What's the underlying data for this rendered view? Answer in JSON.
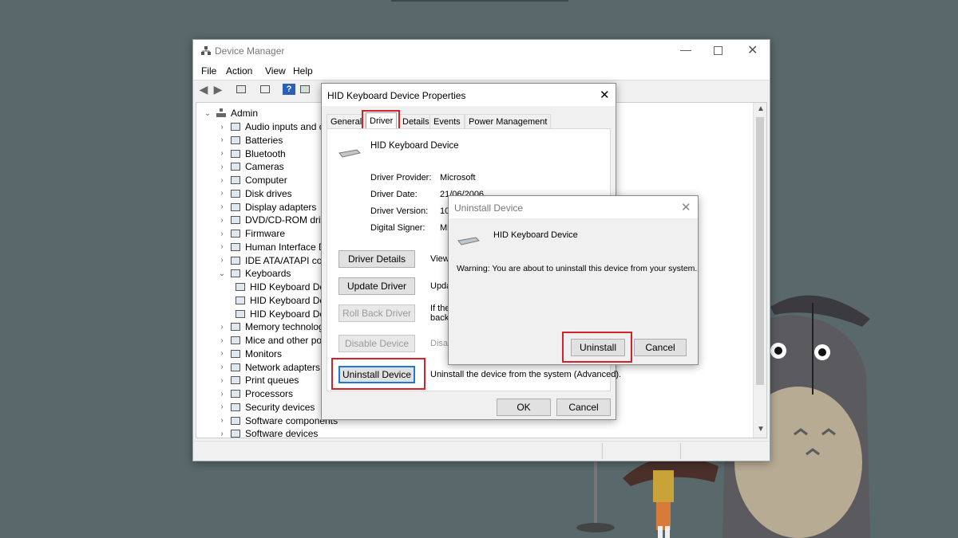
{
  "device_manager": {
    "title": "Device Manager",
    "menu": [
      "File",
      "Action",
      "View",
      "Help"
    ],
    "tree": {
      "root": "Admin",
      "items": [
        {
          "label": "Audio inputs and ou",
          "expanded": false,
          "icon": "speaker-icon"
        },
        {
          "label": "Batteries",
          "expanded": false,
          "icon": "battery-icon"
        },
        {
          "label": "Bluetooth",
          "expanded": false,
          "icon": "bluetooth-icon"
        },
        {
          "label": "Cameras",
          "expanded": false,
          "icon": "camera-icon"
        },
        {
          "label": "Computer",
          "expanded": false,
          "icon": "monitor-icon"
        },
        {
          "label": "Disk drives",
          "expanded": false,
          "icon": "disk-icon"
        },
        {
          "label": "Display adapters",
          "expanded": false,
          "icon": "display-adapter-icon"
        },
        {
          "label": "DVD/CD-ROM drive",
          "expanded": false,
          "icon": "dvd-icon"
        },
        {
          "label": "Firmware",
          "expanded": false,
          "icon": "chip-icon"
        },
        {
          "label": "Human Interface De",
          "expanded": false,
          "icon": "hid-icon"
        },
        {
          "label": "IDE ATA/ATAPI contr",
          "expanded": false,
          "icon": "ide-icon"
        },
        {
          "label": "Keyboards",
          "expanded": true,
          "icon": "keyboard-icon"
        },
        {
          "label": "HID Keyboard De",
          "child": true,
          "icon": "keyboard-icon"
        },
        {
          "label": "HID Keyboard De",
          "child": true,
          "icon": "keyboard-icon"
        },
        {
          "label": "HID Keyboard De",
          "child": true,
          "icon": "keyboard-icon"
        },
        {
          "label": "Memory technolog",
          "expanded": false,
          "icon": "memory-icon"
        },
        {
          "label": "Mice and other poin",
          "expanded": false,
          "icon": "mouse-icon"
        },
        {
          "label": "Monitors",
          "expanded": false,
          "icon": "monitor-icon"
        },
        {
          "label": "Network adapters",
          "expanded": false,
          "icon": "network-icon"
        },
        {
          "label": "Print queues",
          "expanded": false,
          "icon": "printer-icon"
        },
        {
          "label": "Processors",
          "expanded": false,
          "icon": "processor-icon"
        },
        {
          "label": "Security devices",
          "expanded": false,
          "icon": "security-icon"
        },
        {
          "label": "Software components",
          "expanded": false,
          "icon": "software-icon"
        },
        {
          "label": "Software devices",
          "expanded": false,
          "icon": "software-device-icon"
        }
      ]
    }
  },
  "properties_dialog": {
    "title": "HID Keyboard Device Properties",
    "tabs": [
      "General",
      "Driver",
      "Details",
      "Events",
      "Power Management"
    ],
    "active_tab": "Driver",
    "device_name": "HID Keyboard Device",
    "fields": [
      {
        "label": "Driver Provider:",
        "value": "Microsoft"
      },
      {
        "label": "Driver Date:",
        "value": "21/06/2006"
      },
      {
        "label": "Driver Version:",
        "value": "10"
      },
      {
        "label": "Digital Signer:",
        "value": "Mi"
      }
    ],
    "actions": [
      {
        "button": "Driver Details",
        "desc": "View",
        "enabled": true
      },
      {
        "button": "Update Driver",
        "desc": "Upda",
        "enabled": true
      },
      {
        "button": "Roll Back Driver",
        "desc": "If the\nback",
        "enabled": false
      },
      {
        "button": "Disable Device",
        "desc": "Disa",
        "enabled": false
      },
      {
        "button": "Uninstall Device",
        "desc": "Uninstall the device from the system (Advanced).",
        "enabled": true
      }
    ],
    "ok_label": "OK",
    "cancel_label": "Cancel"
  },
  "uninstall_dialog": {
    "title": "Uninstall Device",
    "device_name": "HID Keyboard Device",
    "warning": "Warning: You are about to uninstall this device from your system.",
    "uninstall_label": "Uninstall",
    "cancel_label": "Cancel"
  },
  "colors": {
    "highlight": "#d2232a",
    "background": "#59686a",
    "focus": "#1e78d6"
  }
}
